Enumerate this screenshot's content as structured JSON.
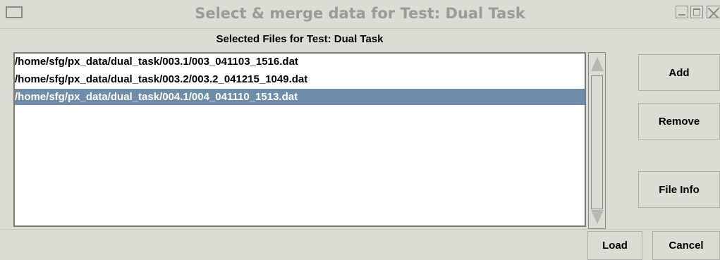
{
  "window": {
    "title": "Select & merge data for Test: Dual Task"
  },
  "panel": {
    "heading": "Selected Files for Test: Dual Task"
  },
  "files": [
    {
      "path": "/home/sfg/px_data/dual_task/003.1/003_041103_1516.dat",
      "selected": false
    },
    {
      "path": "/home/sfg/px_data/dual_task/003.2/003.2_041215_1049.dat",
      "selected": false
    },
    {
      "path": "/home/sfg/px_data/dual_task/004.1/004_041110_1513.dat",
      "selected": true
    }
  ],
  "buttons": {
    "add": "Add",
    "remove": "Remove",
    "file_info": "File Info",
    "load": "Load",
    "cancel": "Cancel"
  },
  "colors": {
    "selection": "#6f8ca8",
    "window_bg": "#dcdcd4"
  }
}
